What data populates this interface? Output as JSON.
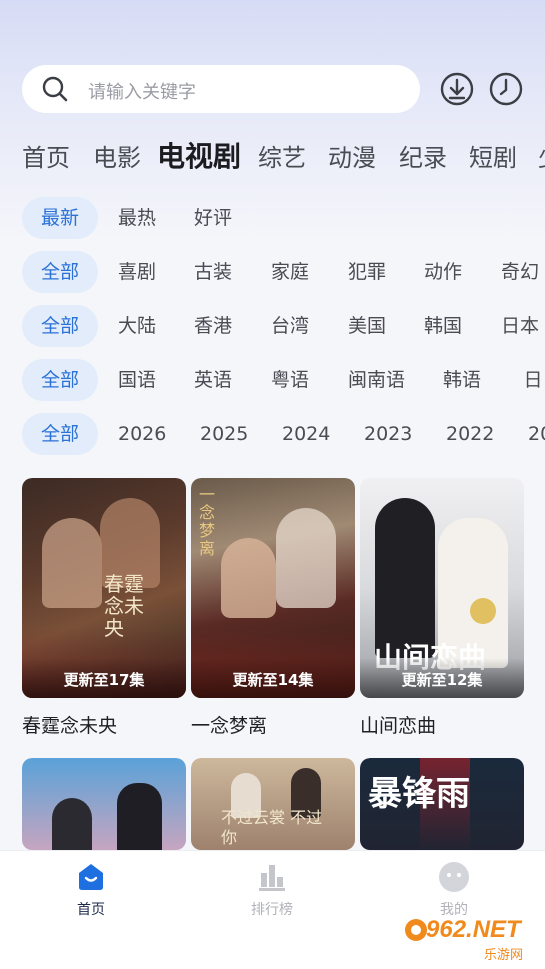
{
  "search": {
    "placeholder": "请输入关键字"
  },
  "categories": [
    "首页",
    "电影",
    "电视剧",
    "综艺",
    "动漫",
    "纪录",
    "短剧",
    "少"
  ],
  "active_category": "电视剧",
  "filters": {
    "sort": [
      "最新",
      "最热",
      "好评"
    ],
    "genre": [
      "全部",
      "喜剧",
      "古装",
      "家庭",
      "犯罪",
      "动作",
      "奇幻"
    ],
    "region": [
      "全部",
      "大陆",
      "香港",
      "台湾",
      "美国",
      "韩国",
      "日本"
    ],
    "language": [
      "全部",
      "国语",
      "英语",
      "粤语",
      "闽南语",
      "韩语",
      "日语"
    ],
    "year": [
      "全部",
      "2026",
      "2025",
      "2024",
      "2023",
      "2022",
      "20"
    ]
  },
  "shows": [
    {
      "title": "春霆念未央",
      "badge": "更新至17集",
      "poster_text": "春霆念未央"
    },
    {
      "title": "一念梦离",
      "badge": "更新至14集",
      "poster_text": "一念梦离"
    },
    {
      "title": "山间恋曲",
      "badge": "更新至12集",
      "poster_text": "山间恋曲"
    },
    {
      "title": "",
      "badge": "",
      "poster_text": ""
    },
    {
      "title": "",
      "badge": "",
      "poster_text": "不过云裳 不过你"
    },
    {
      "title": "",
      "badge": "",
      "poster_text": "暴锋雨"
    }
  ],
  "tabbar": [
    {
      "label": "首页",
      "icon": "home-icon"
    },
    {
      "label": "排行榜",
      "icon": "ranking-icon"
    },
    {
      "label": "我的",
      "icon": "profile-icon"
    }
  ],
  "watermark": {
    "text": "962.NET",
    "sub": "乐游网"
  },
  "colors": {
    "accent": "#2a72d8",
    "chip_bg": "#e2ecfb",
    "tab_active": "#1e6fe0"
  }
}
